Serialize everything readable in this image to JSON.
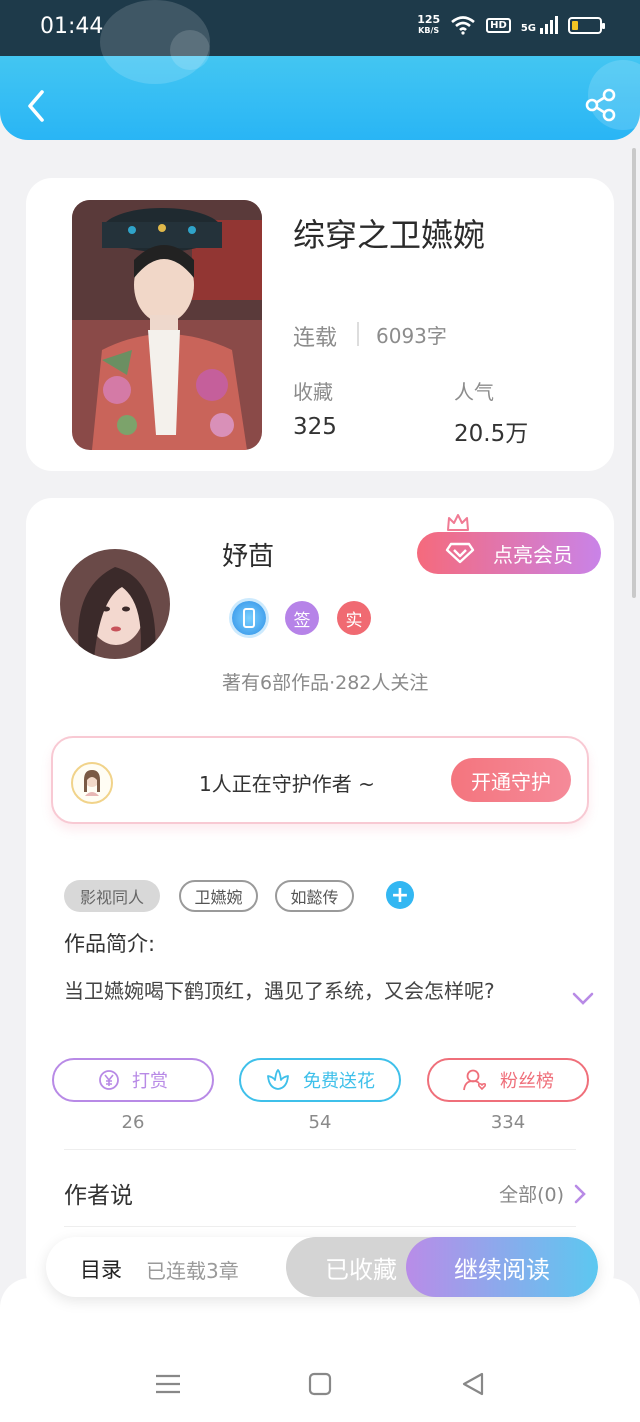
{
  "status_bar": {
    "time": "01:44",
    "speed_value": "125",
    "speed_unit": "KB/S",
    "hd": "HD",
    "network": "5G",
    "icons": [
      "wifi-icon",
      "signal-icon",
      "battery-icon"
    ]
  },
  "header": {
    "icons": [
      "back-arrow-icon",
      "share-icon"
    ]
  },
  "book": {
    "title": "综穿之卫嬿婉",
    "status": "连载",
    "word_count": "6093字",
    "collect_label": "收藏",
    "collect_value": "325",
    "popularity_label": "人气",
    "popularity_value": "20.5万"
  },
  "author": {
    "name": "妤茴",
    "vip_button": "点亮会员",
    "badges": [
      {
        "text": "",
        "icon": "phone-verified-icon",
        "color": "#35a6f0"
      },
      {
        "text": "签",
        "color": "#b683e8"
      },
      {
        "text": "实",
        "color": "#f06a72"
      }
    ],
    "meta": "著有6部作品·282人关注"
  },
  "guard": {
    "text": "1人正在守护作者 ~",
    "button": "开通守护"
  },
  "tags": [
    {
      "label": "影视同人",
      "style": "filled"
    },
    {
      "label": "卫嬿婉",
      "style": "outline"
    },
    {
      "label": "如懿传",
      "style": "outline"
    }
  ],
  "intro": {
    "title": "作品简介:",
    "text": "当卫嬿婉喝下鹤顶红，遇见了系统，又会怎样呢?"
  },
  "actions": [
    {
      "label": "打赏",
      "count": "26",
      "color": "#b88ae6",
      "icon": "yen-icon"
    },
    {
      "label": "免费送花",
      "count": "54",
      "color": "#3fc0ea",
      "icon": "flower-icon"
    },
    {
      "label": "粉丝榜",
      "count": "334",
      "color": "#ef6f7a",
      "icon": "fans-icon"
    }
  ],
  "author_say": {
    "title": "作者说",
    "link": "全部(0)"
  },
  "bottom_bar": {
    "toc": "目录",
    "chapters": "已连载3章",
    "collected": "已收藏",
    "continue": "继续阅读"
  }
}
